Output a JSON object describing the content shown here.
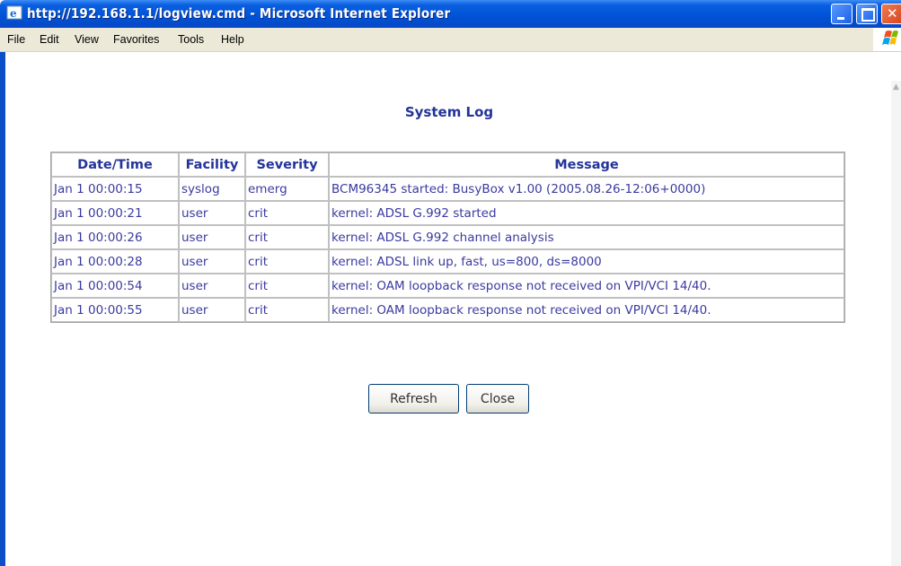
{
  "window": {
    "title": "http://192.168.1.1/logview.cmd - Microsoft Internet Explorer",
    "accent_color": "#0052d6"
  },
  "menubar": {
    "items": [
      "File",
      "Edit",
      "View",
      "Favorites",
      "Tools",
      "Help"
    ]
  },
  "page": {
    "heading": "System Log",
    "table": {
      "headers": [
        "Date/Time",
        "Facility",
        "Severity",
        "Message"
      ],
      "rows": [
        [
          "Jan 1 00:00:15",
          "syslog",
          "emerg",
          "BCM96345 started: BusyBox v1.00 (2005.08.26-12:06+0000)"
        ],
        [
          "Jan 1 00:00:21",
          "user",
          "crit",
          "kernel: ADSL G.992 started"
        ],
        [
          "Jan 1 00:00:26",
          "user",
          "crit",
          "kernel: ADSL G.992 channel analysis"
        ],
        [
          "Jan 1 00:00:28",
          "user",
          "crit",
          "kernel: ADSL link up, fast, us=800, ds=8000"
        ],
        [
          "Jan 1 00:00:54",
          "user",
          "crit",
          "kernel: OAM loopback response not received on VPI/VCI 14/40."
        ],
        [
          "Jan 1 00:00:55",
          "user",
          "crit",
          "kernel: OAM loopback response not received on VPI/VCI 14/40."
        ]
      ]
    },
    "buttons": {
      "refresh": "Refresh",
      "close": "Close"
    }
  },
  "icons": {
    "app": "ie-icon",
    "minimize": "minimize-icon",
    "maximize": "maximize-icon",
    "close": "close-icon",
    "brand": "windows-logo-icon"
  }
}
